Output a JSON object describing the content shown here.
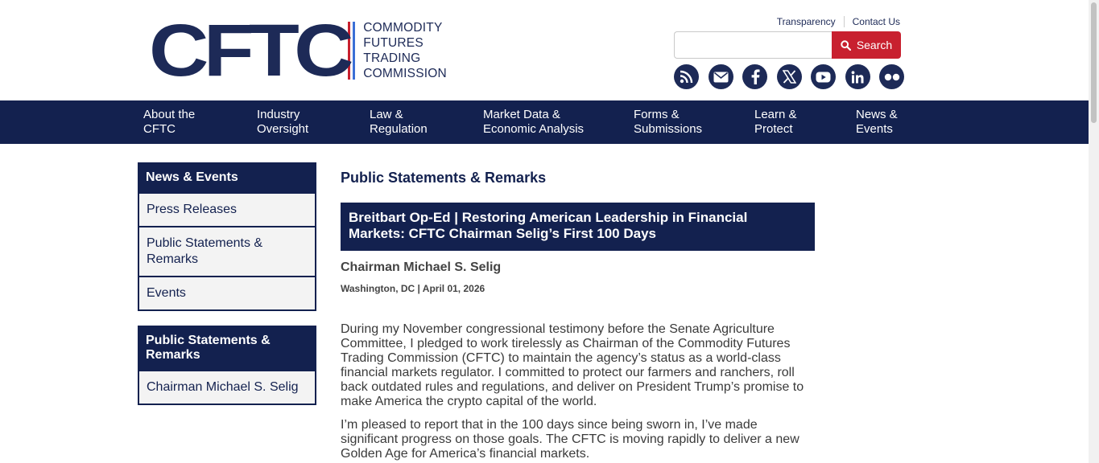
{
  "logo": {
    "mark": "CFTC",
    "lines": [
      "COMMODITY",
      "FUTURES",
      "TRADING",
      "COMMISSION"
    ],
    "bar_colors": [
      "#c8202f",
      "#3b6fd6"
    ]
  },
  "utility_links": {
    "transparency": "Transparency",
    "contact": "Contact Us"
  },
  "search": {
    "placeholder": "",
    "button_label": "Search",
    "button_color": "#c8202f"
  },
  "social_icons": [
    "rss-icon",
    "email-icon",
    "facebook-icon",
    "x-icon",
    "youtube-icon",
    "linkedin-icon",
    "flickr-icon"
  ],
  "nav": {
    "items": [
      {
        "label": "About the\nCFTC"
      },
      {
        "label": "Industry\nOversight"
      },
      {
        "label": "Law &\nRegulation"
      },
      {
        "label": "Market Data &\nEconomic Analysis"
      },
      {
        "label": "Forms &\nSubmissions"
      },
      {
        "label": "Learn &\nProtect"
      },
      {
        "label": "News &\nEvents"
      }
    ]
  },
  "sidebar": {
    "news_events": {
      "title": "News & Events",
      "items": [
        "Press Releases",
        "Public Statements & Remarks",
        "Events"
      ]
    },
    "statements": {
      "title": "Public Statements & Remarks",
      "items": [
        "Chairman Michael S. Selig"
      ]
    }
  },
  "main": {
    "section_title": "Public Statements & Remarks",
    "headline": "Breitbart Op-Ed | Restoring American Leadership in Financial Markets: CFTC Chairman Selig’s First 100 Days",
    "byline": "Chairman Michael S. Selig",
    "dateline": "Washington, DC | April 01, 2026",
    "paragraphs": [
      "During my November congressional testimony before the Senate Agriculture Committee, I pledged to work tirelessly as Chairman of the Commodity Futures Trading Commission (CFTC) to maintain the agency’s status as a world-class financial markets regulator. I committed to protect our farmers and ranchers, roll back outdated rules and regulations, and deliver on President Trump’s promise to make America the crypto capital of the world.",
      "I’m pleased to report that in the 100 days since being sworn in, I’ve made significant progress on those goals. The CFTC is moving rapidly to deliver a new Golden Age for America’s financial markets."
    ]
  },
  "colors": {
    "navy": "#13214f",
    "logo_navy": "#1d2a57",
    "red": "#c8202f"
  }
}
